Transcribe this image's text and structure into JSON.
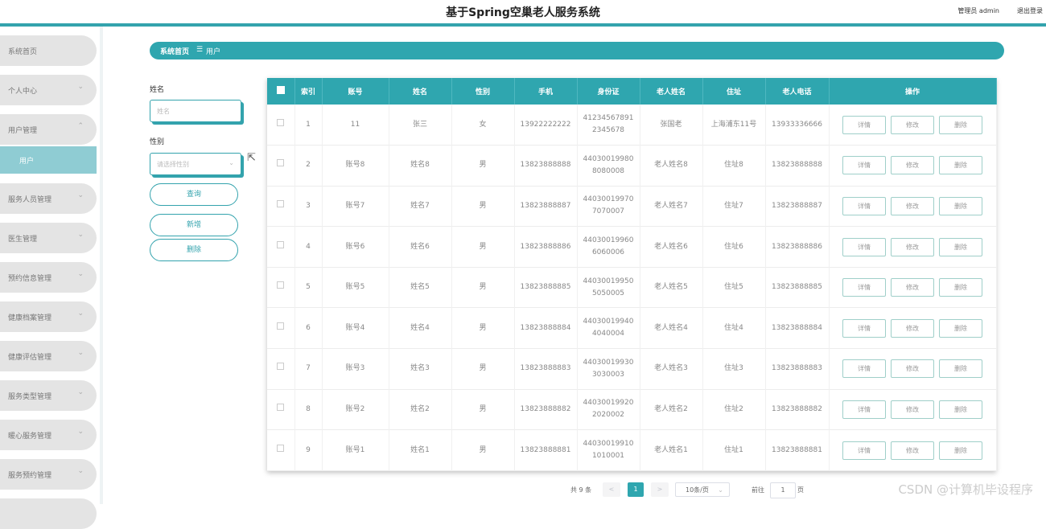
{
  "header": {
    "title": "基于Spring空巢老人服务系统",
    "admin": "管理员 admin",
    "logout": "退出登录"
  },
  "sidebar": {
    "items": [
      {
        "label": "系统首页",
        "chevron": ""
      },
      {
        "label": "个人中心",
        "chevron": "⌄"
      },
      {
        "label": "用户管理",
        "chevron": "⌃"
      },
      {
        "label": "服务人员管理",
        "chevron": "⌄"
      },
      {
        "label": "医生管理",
        "chevron": "⌄"
      },
      {
        "label": "预约信息管理",
        "chevron": "⌄"
      },
      {
        "label": "健康档案管理",
        "chevron": "⌄"
      },
      {
        "label": "健康评估管理",
        "chevron": "⌄"
      },
      {
        "label": "服务类型管理",
        "chevron": "⌄"
      },
      {
        "label": "暖心服务管理",
        "chevron": "⌄"
      },
      {
        "label": "服务预约管理",
        "chevron": "⌄"
      }
    ],
    "sub_item": "用户"
  },
  "breadcrumb": {
    "home": "系统首页",
    "sep": "☰",
    "current": "用户"
  },
  "search": {
    "name_label": "姓名",
    "name_placeholder": "姓名",
    "gender_label": "性别",
    "gender_placeholder": "请选择性别",
    "query_button": "查询",
    "add_button": "新增",
    "delete_button": "删除"
  },
  "table": {
    "headers": [
      "索引",
      "账号",
      "姓名",
      "性别",
      "手机",
      "身份证",
      "老人姓名",
      "住址",
      "老人电话",
      "操作"
    ],
    "rows": [
      {
        "index": "1",
        "account": "11",
        "name": "张三",
        "gender": "女",
        "phone": "13922222222",
        "id_line1": "41234567891",
        "id_line2": "2345678",
        "elder": "张国老",
        "address": "上海浦东11号",
        "elder_phone": "13933336666"
      },
      {
        "index": "2",
        "account": "账号8",
        "name": "姓名8",
        "gender": "男",
        "phone": "13823888888",
        "id_line1": "44030019980",
        "id_line2": "8080008",
        "elder": "老人姓名8",
        "address": "住址8",
        "elder_phone": "13823888888"
      },
      {
        "index": "3",
        "account": "账号7",
        "name": "姓名7",
        "gender": "男",
        "phone": "13823888887",
        "id_line1": "44030019970",
        "id_line2": "7070007",
        "elder": "老人姓名7",
        "address": "住址7",
        "elder_phone": "13823888887"
      },
      {
        "index": "4",
        "account": "账号6",
        "name": "姓名6",
        "gender": "男",
        "phone": "13823888886",
        "id_line1": "44030019960",
        "id_line2": "6060006",
        "elder": "老人姓名6",
        "address": "住址6",
        "elder_phone": "13823888886"
      },
      {
        "index": "5",
        "account": "账号5",
        "name": "姓名5",
        "gender": "男",
        "phone": "13823888885",
        "id_line1": "44030019950",
        "id_line2": "5050005",
        "elder": "老人姓名5",
        "address": "住址5",
        "elder_phone": "13823888885"
      },
      {
        "index": "6",
        "account": "账号4",
        "name": "姓名4",
        "gender": "男",
        "phone": "13823888884",
        "id_line1": "44030019940",
        "id_line2": "4040004",
        "elder": "老人姓名4",
        "address": "住址4",
        "elder_phone": "13823888884"
      },
      {
        "index": "7",
        "account": "账号3",
        "name": "姓名3",
        "gender": "男",
        "phone": "13823888883",
        "id_line1": "44030019930",
        "id_line2": "3030003",
        "elder": "老人姓名3",
        "address": "住址3",
        "elder_phone": "13823888883"
      },
      {
        "index": "8",
        "account": "账号2",
        "name": "姓名2",
        "gender": "男",
        "phone": "13823888882",
        "id_line1": "44030019920",
        "id_line2": "2020002",
        "elder": "老人姓名2",
        "address": "住址2",
        "elder_phone": "13823888882"
      },
      {
        "index": "9",
        "account": "账号1",
        "name": "姓名1",
        "gender": "男",
        "phone": "13823888881",
        "id_line1": "44030019910",
        "id_line2": "1010001",
        "elder": "老人姓名1",
        "address": "住址1",
        "elder_phone": "13823888881"
      }
    ],
    "actions": {
      "detail": "详情",
      "edit": "修改",
      "delete": "删除"
    }
  },
  "pagination": {
    "total": "共 9 条",
    "prev": "<",
    "current_page": "1",
    "next": ">",
    "page_size": "10条/页",
    "goto_label": "前往",
    "goto_value": "1",
    "page_unit": "页"
  },
  "watermark": "CSDN @计算机毕设程序",
  "colors": {
    "accent": "#2fa6af",
    "header_bar": "#33a3ad",
    "sidebar_item": "#e4e4e4",
    "sidebar_active": "#8fccd3"
  }
}
